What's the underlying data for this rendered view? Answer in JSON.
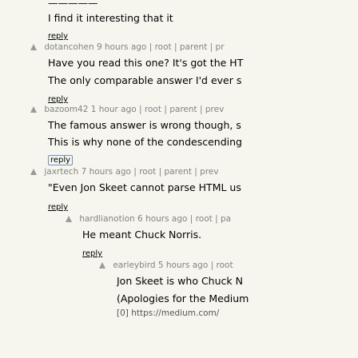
{
  "c0": {
    "top_fragment": "—————",
    "text_lines": [
      "I find it interesting that it"
    ],
    "reply_label": "reply"
  },
  "c1": {
    "user": "dotancohen",
    "age": "9 hours ago",
    "links": [
      "root",
      "parent",
      "pr"
    ],
    "text_lines": [
      "Have you read this one? It's got the HT",
      "The only comparable answer I'd ever s"
    ],
    "reply_label": "reply"
  },
  "c2": {
    "user": "bazoom42",
    "age": "1 hour ago",
    "links": [
      "root",
      "parent",
      "prev"
    ],
    "text_lines": [
      "The famous answer is wrong though, s",
      "This is why none of the condescending"
    ],
    "reply_label": "reply"
  },
  "c3": {
    "user": "jaxrtech",
    "age": "7 hours ago",
    "links": [
      "root",
      "parent",
      "prev"
    ],
    "text_lines": [
      "\"Even Jon Skeet cannot parse HTML us"
    ],
    "reply_label": "reply"
  },
  "c4": {
    "user": "hardlianotion",
    "age": "6 hours ago",
    "links": [
      "root",
      "pa"
    ],
    "text_lines": [
      "He meant Chuck Norris."
    ],
    "reply_label": "reply"
  },
  "c5": {
    "user": "earleybird",
    "age": "5 hours ago",
    "links": [
      "root"
    ],
    "text_lines": [
      "Jon Skeet is who Chuck N",
      "(Apologies for the Medium",
      "[0] https://medium.com/"
    ]
  },
  "separator": " | "
}
